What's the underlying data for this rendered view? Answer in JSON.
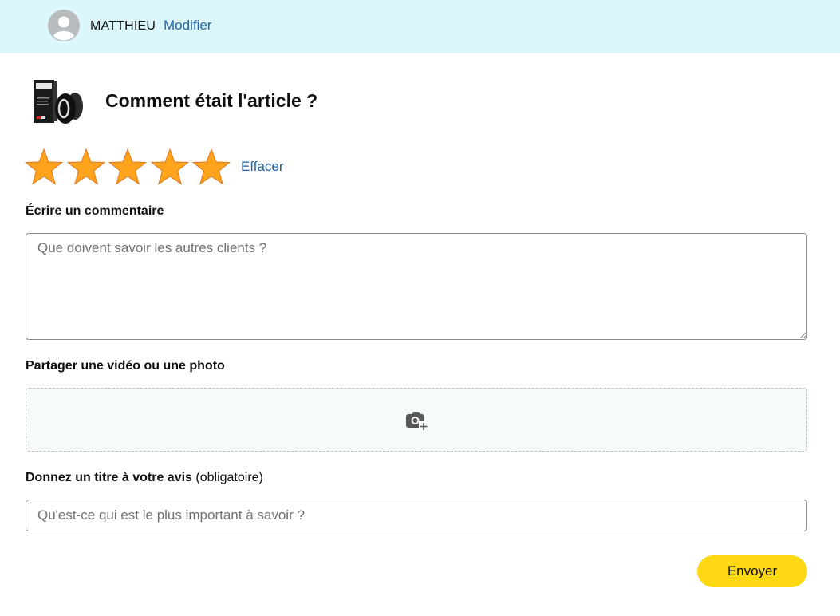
{
  "header": {
    "user_name": "MATTHIEU",
    "modify_label": "Modifier",
    "background_color": "#dbf7fc",
    "link_color": "#2162a1"
  },
  "product": {
    "question": "Comment était l'article ?",
    "image_icon": "product-image"
  },
  "rating": {
    "value": 5,
    "max": 5,
    "star_color": "#ffa41c",
    "clear_label": "Effacer"
  },
  "comment": {
    "label": "Écrire un commentaire",
    "value": "",
    "placeholder": "Que doivent savoir les autres clients ?"
  },
  "media": {
    "label": "Partager une vidéo ou une photo",
    "icon": "camera-add-icon"
  },
  "review_title": {
    "label": "Donnez un titre à votre avis",
    "qualifier": "(obligatoire)",
    "value": "",
    "placeholder": "Qu'est-ce qui est le plus important à savoir ?"
  },
  "submit": {
    "label": "Envoyer",
    "color": "#ffd814"
  }
}
